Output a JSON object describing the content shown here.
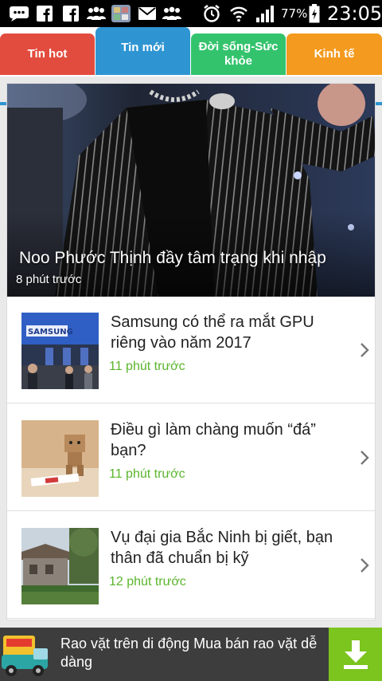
{
  "status_bar": {
    "battery_percent": "77%",
    "time": "23:05",
    "icons": [
      "chat-icon",
      "facebook-icon",
      "facebook-icon",
      "group-icon",
      "app-icon",
      "email-icon",
      "group-icon",
      "alarm-icon",
      "wifi-icon",
      "signal-icon",
      "battery-icon"
    ]
  },
  "tabs": [
    {
      "label": "Tin hot",
      "color": "#e24c3e"
    },
    {
      "label": "Tin mới",
      "color": "#2f95d2",
      "selected": true
    },
    {
      "label": "Đời sống-Sức khỏe",
      "color": "#34c36d"
    },
    {
      "label": "Kinh tế",
      "color": "#f49a1e"
    }
  ],
  "featured": {
    "title": "Noo Phước Thịnh đầy tâm trạng khi nhập",
    "time": "8 phút trước"
  },
  "news": [
    {
      "title": "Samsung có thể ra mắt GPU riêng vào năm 2017",
      "time": "11 phút trước"
    },
    {
      "title": "Điều gì làm chàng muốn “đá” bạn?",
      "time": "11 phút trước"
    },
    {
      "title": "Vụ đại gia Bắc Ninh bị giết, bạn thân đã chuẩn bị kỹ",
      "time": "12 phút trước"
    }
  ],
  "ad": {
    "text": "Rao vặt trên di động Mua bán rao vặt dễ dàng",
    "accent": "#7cc41e"
  }
}
